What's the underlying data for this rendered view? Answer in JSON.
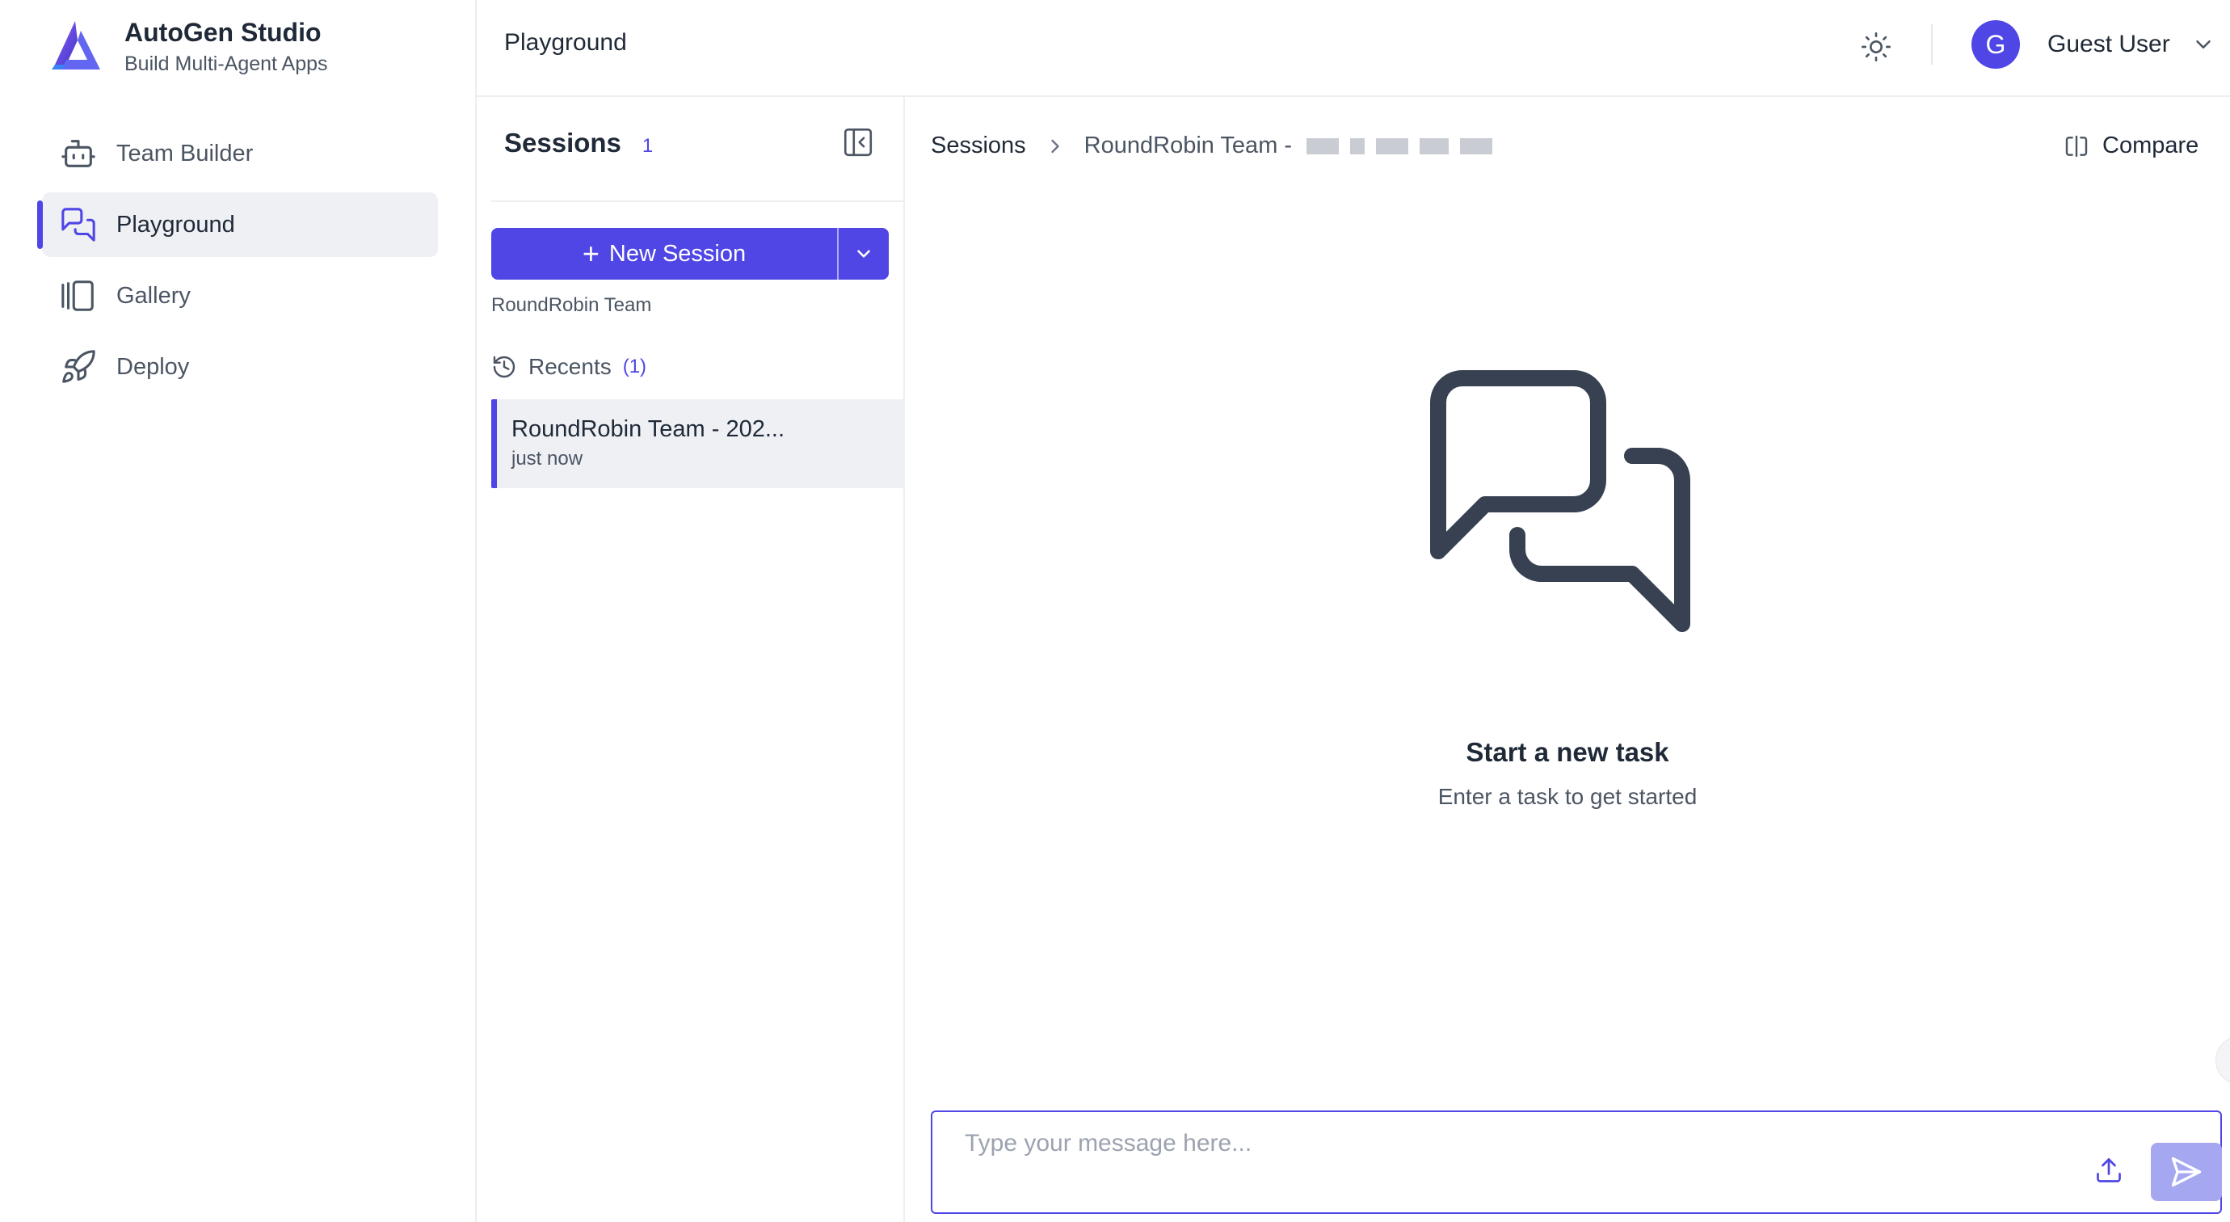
{
  "brand": {
    "title": "AutoGen Studio",
    "subtitle": "Build Multi-Agent Apps"
  },
  "nav": {
    "items": [
      {
        "label": "Team Builder",
        "icon": "robot-icon",
        "active": false
      },
      {
        "label": "Playground",
        "icon": "chat-bubbles-icon",
        "active": true
      },
      {
        "label": "Gallery",
        "icon": "gallery-icon",
        "active": false
      },
      {
        "label": "Deploy",
        "icon": "rocket-icon",
        "active": false
      }
    ]
  },
  "header": {
    "page_title": "Playground",
    "theme_icon": "sun-icon",
    "user": {
      "initial": "G",
      "name": "Guest User"
    }
  },
  "sessions": {
    "title": "Sessions",
    "count": "1",
    "new_session_label": "New Session",
    "team_label": "RoundRobin Team",
    "recents_label": "Recents",
    "recents_count": "(1)",
    "items": [
      {
        "name": "RoundRobin Team - 202...",
        "time": "just now"
      }
    ]
  },
  "main": {
    "breadcrumb_root": "Sessions",
    "breadcrumb_current": "RoundRobin Team -",
    "compare_label": "Compare",
    "empty_title": "Start a new task",
    "empty_subtitle": "Enter a task to get started",
    "input_placeholder": "Type your message here..."
  },
  "colors": {
    "accent": "#4f46e5",
    "send_disabled": "#a5a8f0",
    "active_bg": "#eef0f4",
    "text_primary": "#1f2937",
    "text_secondary": "#4b5563"
  }
}
